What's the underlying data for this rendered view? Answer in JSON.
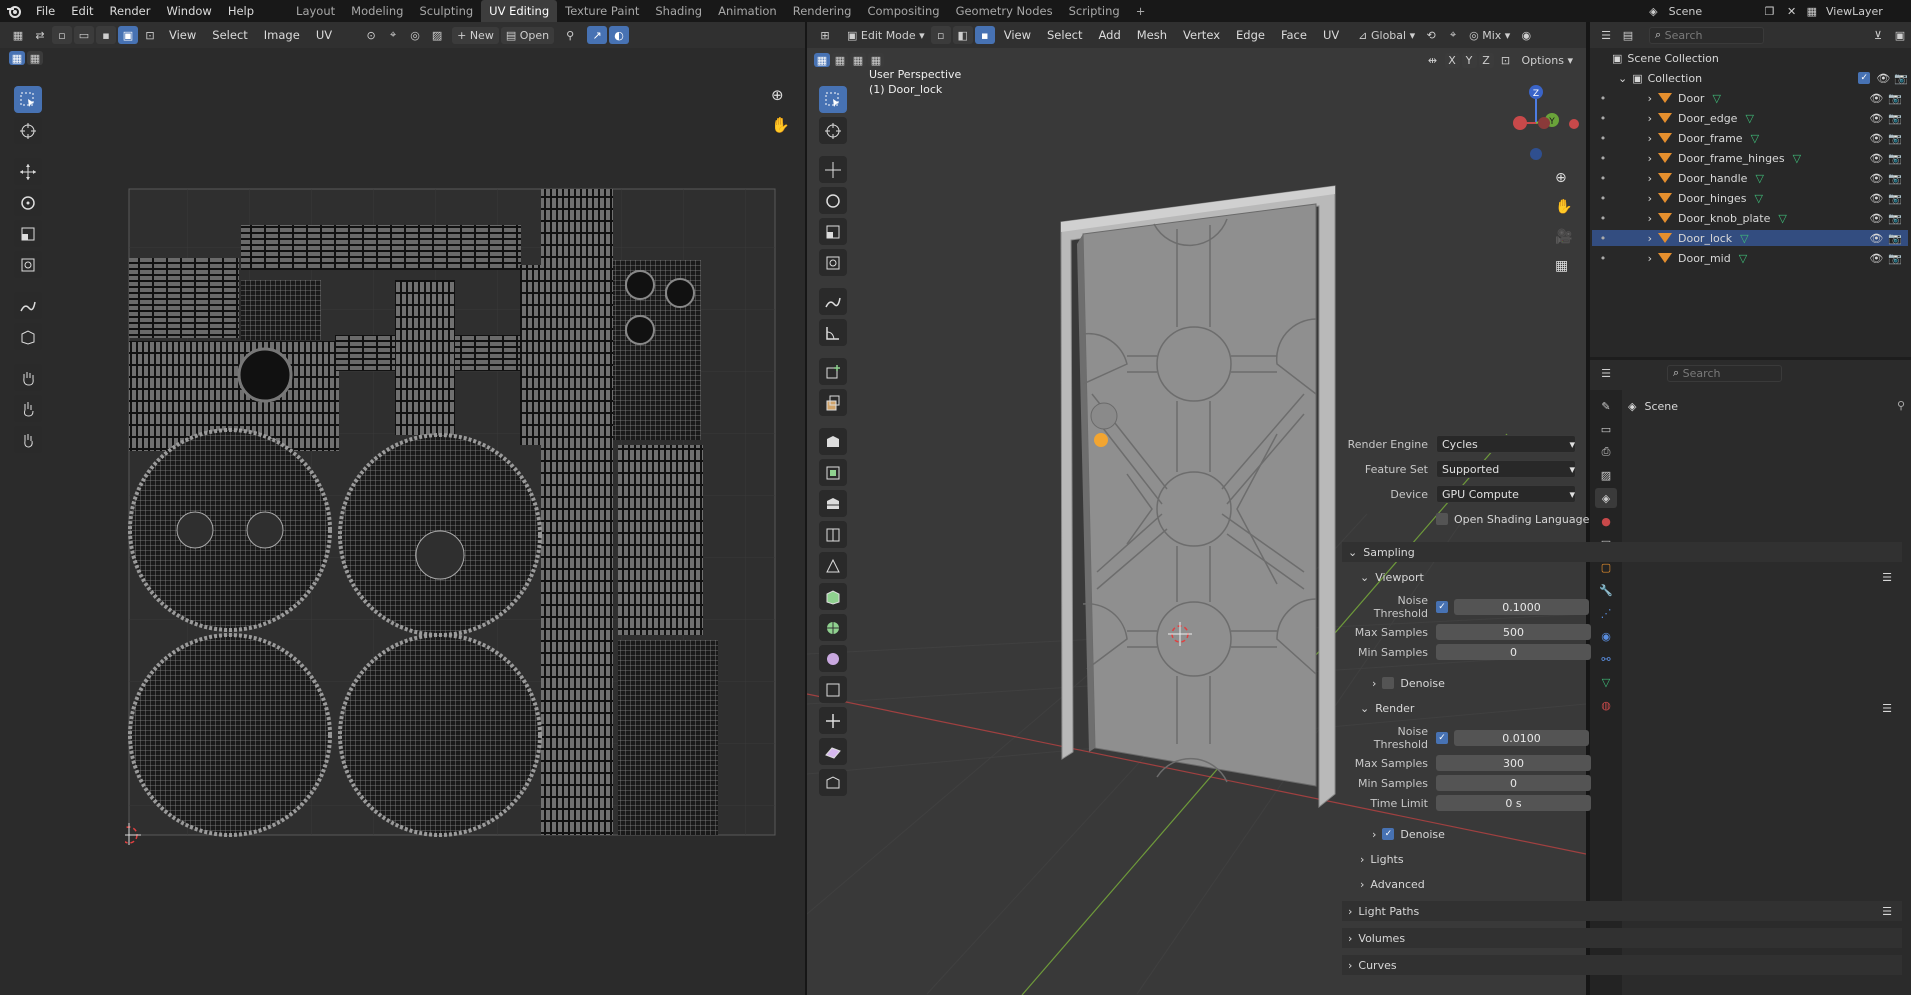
{
  "topbar": {
    "menus": [
      "File",
      "Edit",
      "Render",
      "Window",
      "Help"
    ],
    "workspace_tabs": [
      "Layout",
      "Modeling",
      "Sculpting",
      "UV Editing",
      "Texture Paint",
      "Shading",
      "Animation",
      "Rendering",
      "Compositing",
      "Geometry Nodes",
      "Scripting"
    ],
    "active_tab": "UV Editing",
    "scene": "Scene",
    "view_layer": "ViewLayer"
  },
  "uv_editor": {
    "menus": [
      "View",
      "Select",
      "Image",
      "UV"
    ],
    "new_label": "New",
    "open_label": "Open"
  },
  "viewport": {
    "mode": "Edit Mode",
    "menus": [
      "View",
      "Select",
      "Add",
      "Mesh",
      "Vertex",
      "Edge",
      "Face",
      "UV"
    ],
    "transform_orientation": "Global",
    "shading_mix": "Mix",
    "options_label": "Options",
    "axis_x": "X",
    "axis_y": "Y",
    "axis_z": "Z",
    "overlay_view": "User Perspective",
    "overlay_object": "(1) Door_lock",
    "gizmo_z": "Z",
    "gizmo_y": "Y"
  },
  "outliner": {
    "search_placeholder": "Search",
    "scene_collection": "Scene Collection",
    "collection": "Collection",
    "objects": [
      "Door",
      "Door_edge",
      "Door_frame",
      "Door_frame_hinges",
      "Door_handle",
      "Door_hinges",
      "Door_knob_plate",
      "Door_lock",
      "Door_mid"
    ],
    "selected": "Door_lock"
  },
  "properties": {
    "search_placeholder": "Search",
    "context": "Scene",
    "render_engine_label": "Render Engine",
    "render_engine": "Cycles",
    "feature_set_label": "Feature Set",
    "feature_set": "Supported",
    "device_label": "Device",
    "device": "GPU Compute",
    "osl_label": "Open Shading Language",
    "sampling": "Sampling",
    "viewport": "Viewport",
    "noise_threshold_label": "Noise Threshold",
    "viewport_noise_threshold": "0.1000",
    "max_samples_label": "Max Samples",
    "viewport_max_samples": "500",
    "min_samples_label": "Min Samples",
    "viewport_min_samples": "0",
    "denoise_label": "Denoise",
    "render": "Render",
    "render_noise_threshold": "0.0100",
    "render_max_samples": "300",
    "render_min_samples": "0",
    "time_limit_label": "Time Limit",
    "time_limit": "0 s",
    "lights": "Lights",
    "advanced": "Advanced",
    "light_paths": "Light Paths",
    "volumes": "Volumes",
    "curves": "Curves"
  },
  "colors": {
    "accent": "#4772b3",
    "selection": "#334d80",
    "object_origin": "#f2a531",
    "x_axis": "#c8494a",
    "y_axis": "#7fb545"
  }
}
